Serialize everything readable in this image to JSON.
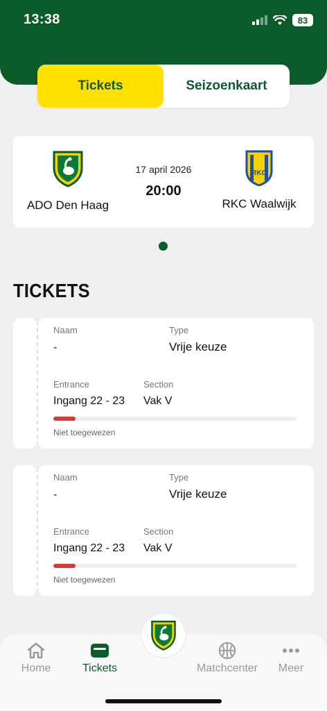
{
  "status": {
    "time": "13:38",
    "battery": "83"
  },
  "tabs": {
    "tickets": "Tickets",
    "seizoenkaart": "Seizoenkaart"
  },
  "match": {
    "home": "ADO Den Haag",
    "away": "RKC Waalwijk",
    "date": "17 april 2026",
    "time": "20:00",
    "away_logo_text": "RKC"
  },
  "section_title": "TICKETS",
  "tickets": [
    {
      "naam_label": "Naam",
      "naam": "-",
      "type_label": "Type",
      "type": "Vrije keuze",
      "entrance_label": "Entrance",
      "entrance": "Ingang 22 - 23",
      "section_label": "Section",
      "section": "Vak V",
      "progress": 0.09,
      "status": "Niet toegewezen"
    },
    {
      "naam_label": "Naam",
      "naam": "-",
      "type_label": "Type",
      "type": "Vrije keuze",
      "entrance_label": "Entrance",
      "entrance": "Ingang 22 - 23",
      "section_label": "Section",
      "section": "Vak V",
      "progress": 0.09,
      "status": "Niet toegewezen"
    }
  ],
  "nav": {
    "home": "Home",
    "tickets": "Tickets",
    "matchcenter": "Matchcenter",
    "meer": "Meer"
  },
  "colors": {
    "primary": "#0b5b2b",
    "accent": "#ffe000",
    "progress": "#d93838"
  },
  "icons": {
    "home": "home-icon",
    "tickets": "ticket-icon",
    "matchcenter": "basketball-icon",
    "meer": "more-icon"
  }
}
